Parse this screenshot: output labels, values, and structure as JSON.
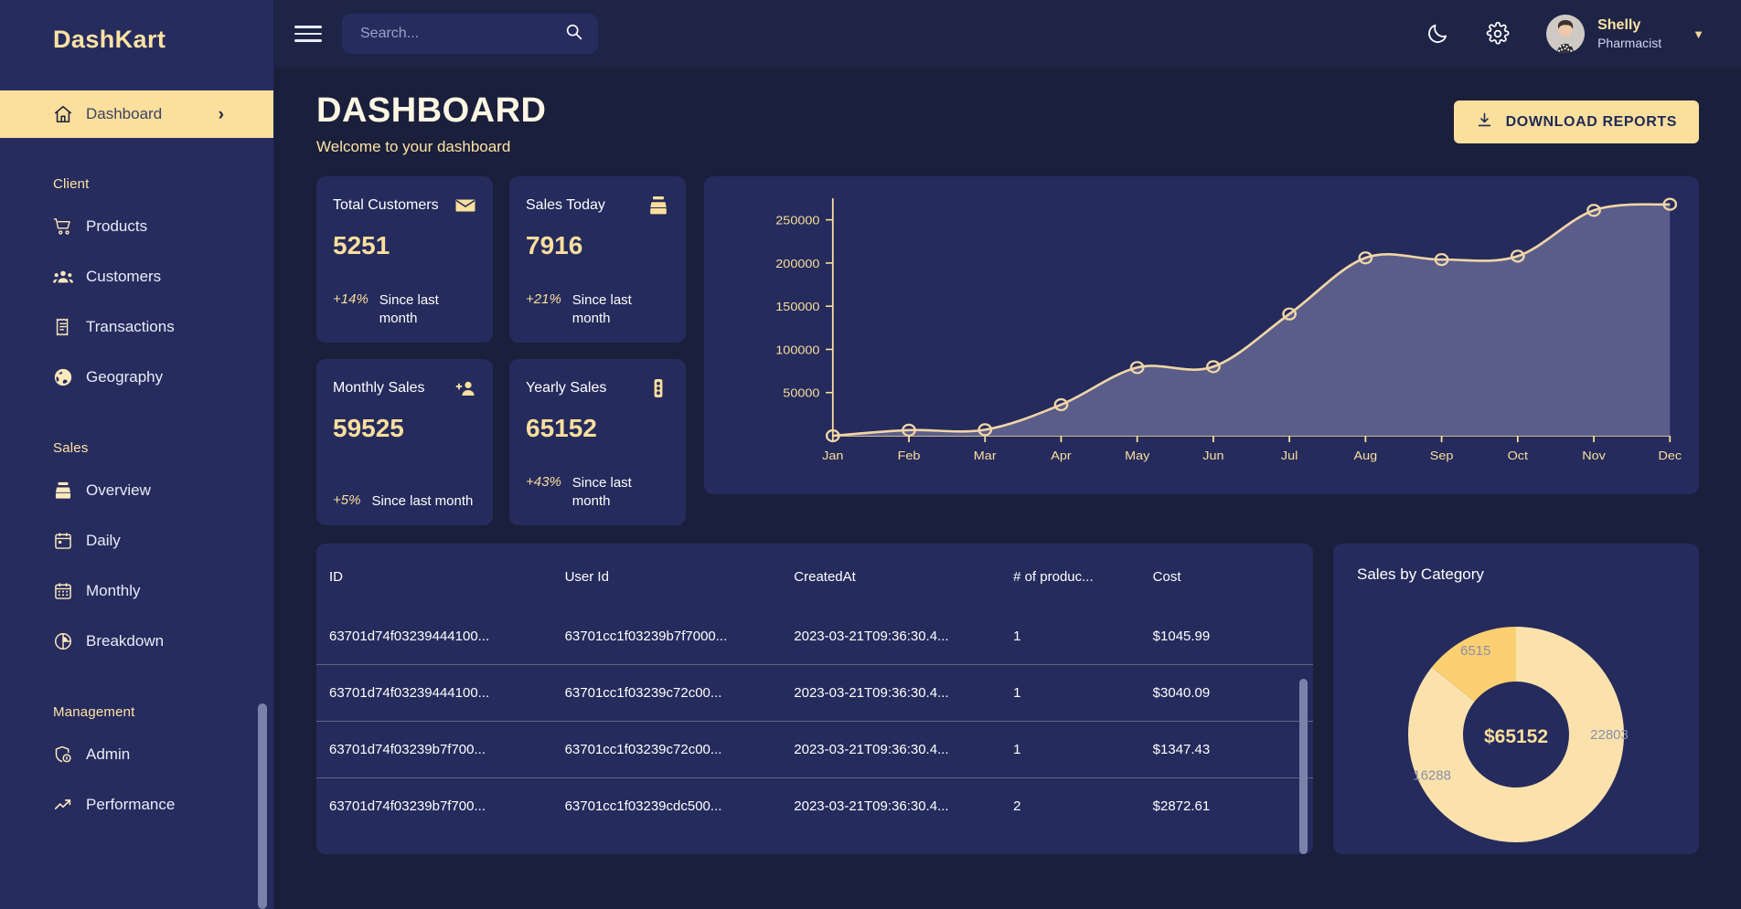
{
  "brand": "DashKart",
  "sidebar": {
    "active": {
      "label": "Dashboard",
      "icon": "home-icon",
      "chevron": "›"
    },
    "sections": [
      {
        "title": "Client",
        "items": [
          {
            "label": "Products",
            "icon": "shopping-cart-icon"
          },
          {
            "label": "Customers",
            "icon": "groups-icon"
          },
          {
            "label": "Transactions",
            "icon": "receipt-icon"
          },
          {
            "label": "Geography",
            "icon": "globe-icon"
          }
        ]
      },
      {
        "title": "Sales",
        "items": [
          {
            "label": "Overview",
            "icon": "point-of-sale-icon"
          },
          {
            "label": "Daily",
            "icon": "calendar-today-icon"
          },
          {
            "label": "Monthly",
            "icon": "calendar-month-icon"
          },
          {
            "label": "Breakdown",
            "icon": "pie-chart-icon"
          }
        ]
      },
      {
        "title": "Management",
        "items": [
          {
            "label": "Admin",
            "icon": "admin-panel-icon"
          },
          {
            "label": "Performance",
            "icon": "trending-up-icon"
          }
        ]
      }
    ]
  },
  "topbar": {
    "menu_icon": "hamburger-icon",
    "search": {
      "value": "",
      "placeholder": "Search..."
    },
    "search_icon": "search-icon",
    "theme_icon": "dark-mode-moon-icon",
    "settings_icon": "gear-icon",
    "avatar_icon": "user-avatar",
    "user_name": "Shelly",
    "user_role": "Pharmacist",
    "caret_icon": "arrow-drop-down-icon"
  },
  "header": {
    "title": "DASHBOARD",
    "subtitle": "Welcome to your dashboard",
    "download_label": "DOWNLOAD REPORTS",
    "download_icon": "download-icon"
  },
  "stats": [
    {
      "label": "Total Customers",
      "value": "5251",
      "pct": "+14%",
      "note": "Since last month",
      "icon": "email-icon"
    },
    {
      "label": "Sales Today",
      "value": "7916",
      "pct": "+21%",
      "note": "Since last month",
      "icon": "point-of-sale-icon"
    },
    {
      "label": "Monthly Sales",
      "value": "59525",
      "pct": "+5%",
      "note": "Since last month",
      "icon": "person-add-icon"
    },
    {
      "label": "Yearly Sales",
      "value": "65152",
      "pct": "+43%",
      "note": "Since last month",
      "icon": "traffic-light-icon"
    }
  ],
  "table": {
    "columns": [
      "ID",
      "User Id",
      "CreatedAt",
      "# of produc...",
      "Cost"
    ],
    "rows": [
      [
        "63701d74f03239444100...",
        "63701cc1f03239b7f7000...",
        "2023-03-21T09:36:30.4...",
        "1",
        "$1045.99"
      ],
      [
        "63701d74f03239444100...",
        "63701cc1f03239c72c00...",
        "2023-03-21T09:36:30.4...",
        "1",
        "$3040.09"
      ],
      [
        "63701d74f03239b7f700...",
        "63701cc1f03239c72c00...",
        "2023-03-21T09:36:30.4...",
        "1",
        "$1347.43"
      ],
      [
        "63701d74f03239b7f700...",
        "63701cc1f03239cdc500...",
        "2023-03-21T09:36:30.4...",
        "2",
        "$2872.61"
      ]
    ]
  },
  "donut": {
    "title": "Sales by Category",
    "center_value": "$65152"
  },
  "colors": {
    "page_bg": "#1a1f3c",
    "sidebar_bg": "#262c5e",
    "card_bg": "#252b5c",
    "accent": "#fbdf9d",
    "accent_light": "#ffe3a3",
    "text": "#ffffff",
    "chart_line": "#f0d5a6",
    "chart_area": "#5d608c"
  },
  "chart_data": [
    {
      "type": "area",
      "id": "monthly-sales-line-chart",
      "title": "",
      "xlabel": "",
      "ylabel": "",
      "categories": [
        "Jan",
        "Feb",
        "Mar",
        "Apr",
        "May",
        "Jun",
        "Jul",
        "Aug",
        "Sep",
        "Oct",
        "Nov",
        "Dec"
      ],
      "values": [
        0,
        6500,
        7000,
        36000,
        79000,
        80000,
        141000,
        206000,
        204000,
        208000,
        261000,
        268000
      ],
      "ylim": [
        0,
        275000
      ],
      "yticks": [
        50000,
        100000,
        150000,
        200000,
        250000
      ],
      "ytick_labels": [
        "50000",
        "100000",
        "150000",
        "200000",
        "250000"
      ],
      "grid": false,
      "legend": "none"
    },
    {
      "type": "pie",
      "id": "sales-by-category-donut",
      "title": "Sales by Category",
      "labels": [
        "22803",
        "16288",
        "6515"
      ],
      "values": [
        22803,
        16288,
        6515
      ],
      "center_label": "$65152",
      "colors": [
        "#fbe2ad",
        "#fbe2ad",
        "#fccf71"
      ],
      "legend": "none"
    }
  ]
}
